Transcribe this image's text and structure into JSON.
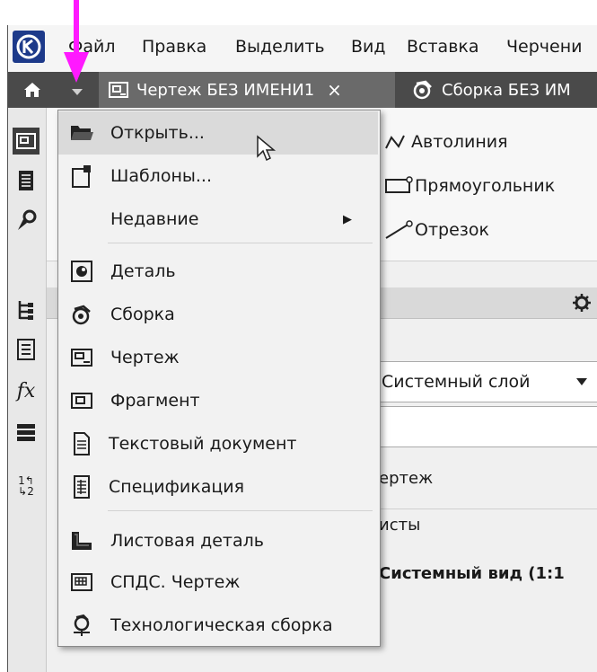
{
  "menubar": {
    "items": [
      "Файл",
      "Правка",
      "Выделить",
      "Вид",
      "Вставка",
      "Черчени"
    ]
  },
  "tabs": [
    {
      "label": "Чертеж БЕЗ ИМЕНИ1",
      "close": "×"
    },
    {
      "label": "Сборка БЕЗ ИМ"
    }
  ],
  "ribbon": {
    "items": [
      "Автолиния",
      "Прямоугольник",
      "Отрезок"
    ]
  },
  "panel": {
    "layer_value": "Системный слой",
    "tree": [
      "ертеж",
      "исты",
      "Системный вид (1:1"
    ]
  },
  "dropdown": {
    "items": [
      {
        "label": "Открыть...",
        "icon": "folder-open-icon"
      },
      {
        "label": "Шаблоны...",
        "icon": "template-icon"
      },
      {
        "label": "Недавние",
        "icon": "",
        "submenu": "▶"
      },
      {
        "label": "Деталь",
        "icon": "part-icon"
      },
      {
        "label": "Сборка",
        "icon": "assembly-icon"
      },
      {
        "label": "Чертеж",
        "icon": "drawing-icon"
      },
      {
        "label": "Фрагмент",
        "icon": "fragment-icon"
      },
      {
        "label": "Текстовый документ",
        "icon": "text-document-icon"
      },
      {
        "label": "Спецификация",
        "icon": "specification-icon"
      },
      {
        "label": "Листовая деталь",
        "icon": "sheet-metal-icon"
      },
      {
        "label": "СПДС. Чертеж",
        "icon": "spds-drawing-icon"
      },
      {
        "label": "Технологическая сборка",
        "icon": "tech-assembly-icon"
      }
    ]
  },
  "annotation": {
    "arrow_color": "#ff19ff"
  },
  "colors": {
    "tab_bar": "#4a4a4a",
    "logo": "#1d3a8a",
    "hover": "#dadada"
  }
}
